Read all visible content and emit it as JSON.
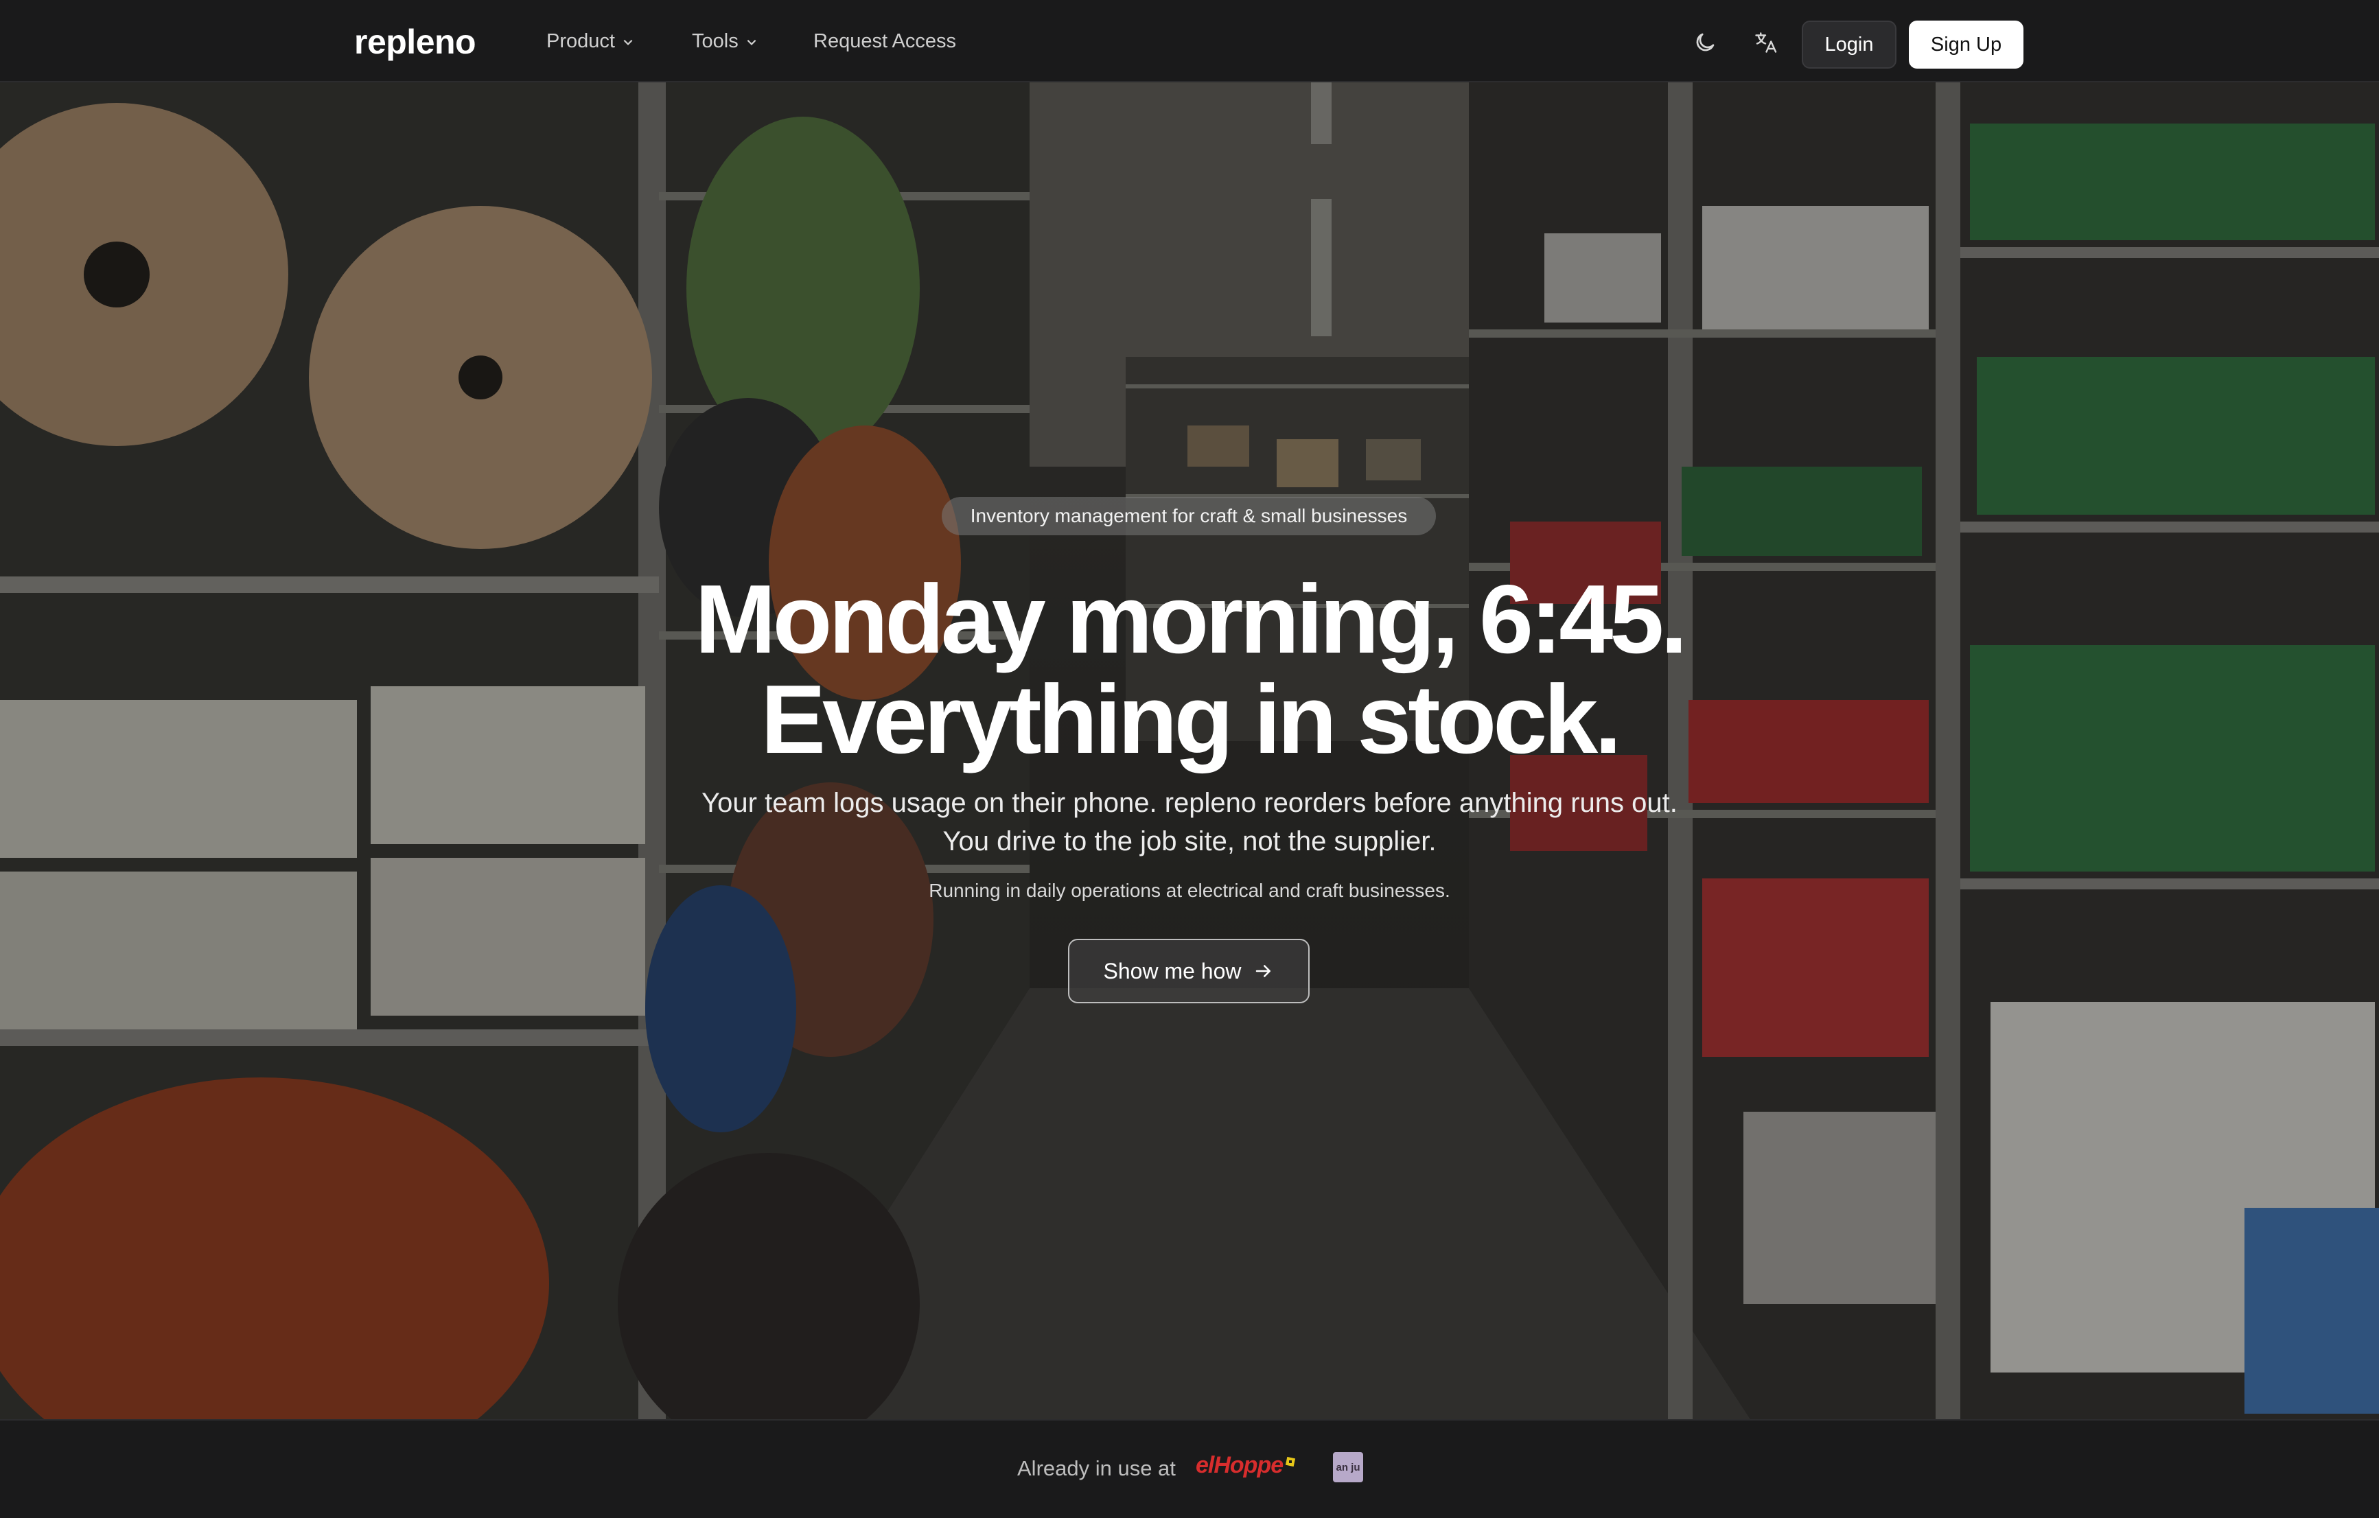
{
  "nav": {
    "logo": "repleno",
    "items": [
      {
        "label": "Product",
        "has_dropdown": true
      },
      {
        "label": "Tools",
        "has_dropdown": true
      },
      {
        "label": "Request Access",
        "has_dropdown": false
      }
    ],
    "theme_toggle_icon": "moon-icon",
    "language_icon": "translate-icon",
    "login_label": "Login",
    "signup_label": "Sign Up"
  },
  "hero": {
    "background": "warehouse-shelves-photo",
    "badge": "Inventory management for craft & small businesses",
    "headline_line1": "Monday morning, 6:45.",
    "headline_line2": "Everything in stock.",
    "sub_line1": "Your team logs usage on their phone. repleno reorders before anything runs out.",
    "sub_line2": "You drive to the job site, not the supplier.",
    "note": "Running in daily operations at electrical and craft businesses.",
    "cta_label": "Show me how",
    "cta_icon": "arrow-right-icon"
  },
  "footer": {
    "label": "Already in use at",
    "customer_logos": [
      {
        "name": "elHoppe-logo",
        "text": "elHoppe"
      },
      {
        "name": "yellow-mark-logo"
      },
      {
        "name": "anju-logo",
        "text": "an ju"
      }
    ]
  },
  "colors": {
    "nav_bg": "#1a1a1b",
    "primary_button": "#ffffff",
    "secondary_button": "#2b2b2d",
    "brand_red": "#d72d2d"
  }
}
